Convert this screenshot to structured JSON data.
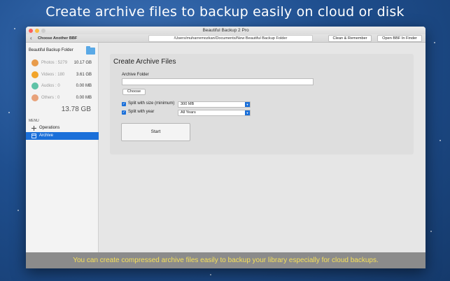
{
  "headline": "Create archive files to backup easily on cloud or disk",
  "window": {
    "title": "Beautiful Backup 2 Pro"
  },
  "toolbar": {
    "back_label": "Choose Another BBF",
    "path": "/Users/muharremozkan/Documents/New Beautiful Backup Folder",
    "clean_button": "Clean & Remember",
    "open_button": "Open BBF In Finder"
  },
  "sidebar": {
    "title": "Beautiful Backup Folder",
    "stats": [
      {
        "label": "Photos : 5279",
        "value": "10.17 GB",
        "icon": "photos-icon",
        "color": "#e89b4a"
      },
      {
        "label": "Videos : 180",
        "value": "3.61 GB",
        "icon": "videos-icon",
        "color": "#f2a42a"
      },
      {
        "label": "Audios : 0",
        "value": "0.00 MB",
        "icon": "audio-icon",
        "color": "#5ec2a6"
      },
      {
        "label": "Others : 0",
        "value": "0.00 MB",
        "icon": "others-icon",
        "color": "#e8a27a"
      }
    ],
    "total": "13.78 GB",
    "menu_heading": "MENU",
    "menu": [
      {
        "label": "Operations",
        "icon": "plus-icon",
        "active": false
      },
      {
        "label": "Archive",
        "icon": "archive-icon",
        "active": true
      }
    ]
  },
  "main": {
    "title": "Create Archive Files",
    "archive_folder_label": "Archive Folder",
    "archive_folder_value": "",
    "choose_button": "Choose",
    "split_size": {
      "label": "Split with size (minimum)",
      "checked": true,
      "selected": "300 MB"
    },
    "split_year": {
      "label": "Split with year",
      "checked": true,
      "selected": "All Years"
    },
    "start_button": "Start"
  },
  "caption": "You can create compressed archive files easily to backup your library especially for cloud backups.",
  "colors": {
    "accent": "#1a6fd9",
    "caption_text": "#f6e05a",
    "caption_bg": "#8b8b8b"
  }
}
